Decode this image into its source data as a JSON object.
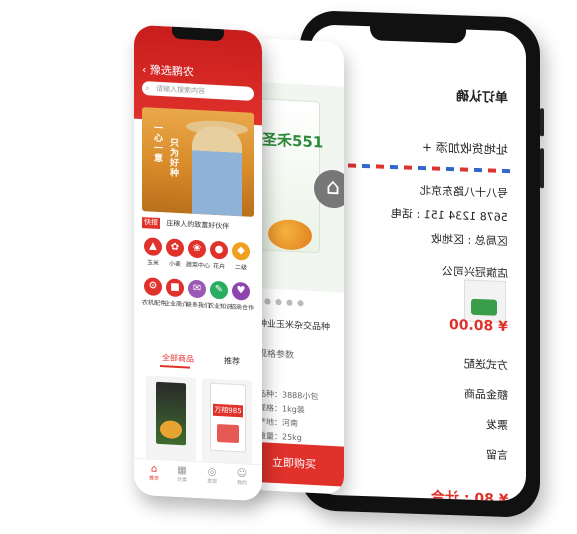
{
  "colors": {
    "accent": "#e0312b",
    "phone_frame": "#111111",
    "success": "#2e8b3a"
  },
  "back_phone": {
    "title": "单订认确",
    "rows": [
      "址地货收加添 +",
      "号八十八路东京北",
      "5678 1234 151 : 话电",
      "区局总 : 区地收",
      "店旗冠兴司公"
    ],
    "price_total": "¥ 80.00",
    "price_bottom": "¥ 80 : 计合",
    "labels": [
      "方式送配",
      "额金品商",
      "票发",
      "言留"
    ]
  },
  "middle_phone": {
    "brand": "圣禾551",
    "home_icon": "home-icon",
    "product_text": "种业玉米杂交品种",
    "params_title": "规格参数",
    "specs": [
      "品种：3888小包",
      "规格：1kg装",
      "产地：河南",
      "重量：25kg"
    ],
    "buy_label": "立即购买"
  },
  "front_phone": {
    "title": "豫选鹏农",
    "search_placeholder": "请输入搜索内容",
    "banner_text_1": "一心一意",
    "banner_text_2": "只为好种",
    "notice_tag": "快报",
    "notice_text": "庄稼人的致富好伙伴",
    "icons_row1": [
      {
        "label": "玉米",
        "color": "#e0312b",
        "glyph": "▲"
      },
      {
        "label": "小麦",
        "color": "#e0312b",
        "glyph": "✿"
      },
      {
        "label": "蔬菜中心",
        "color": "#e0312b",
        "glyph": "❀"
      },
      {
        "label": "花卉",
        "color": "#e0312b",
        "glyph": "●"
      },
      {
        "label": "二级",
        "color": "#f0a020",
        "glyph": "◆"
      }
    ],
    "icons_row2": [
      {
        "label": "农机配件",
        "color": "#e0312b",
        "glyph": "⚙"
      },
      {
        "label": "企业简介",
        "color": "#e0312b",
        "glyph": "■"
      },
      {
        "label": "联系我们",
        "color": "#9b59b6",
        "glyph": "✉"
      },
      {
        "label": "农业知识",
        "color": "#27ae60",
        "glyph": "✎"
      },
      {
        "label": "招商合作",
        "color": "#8e44ad",
        "glyph": "♥"
      }
    ],
    "tab_active": "全部商品",
    "tab_other": "推荐",
    "product_b_label": "万翔985",
    "nav": [
      {
        "label": "首页",
        "glyph": "⌂"
      },
      {
        "label": "分类",
        "glyph": "▦"
      },
      {
        "label": "发现",
        "glyph": "◎"
      },
      {
        "label": "我的",
        "glyph": "☺"
      }
    ]
  }
}
